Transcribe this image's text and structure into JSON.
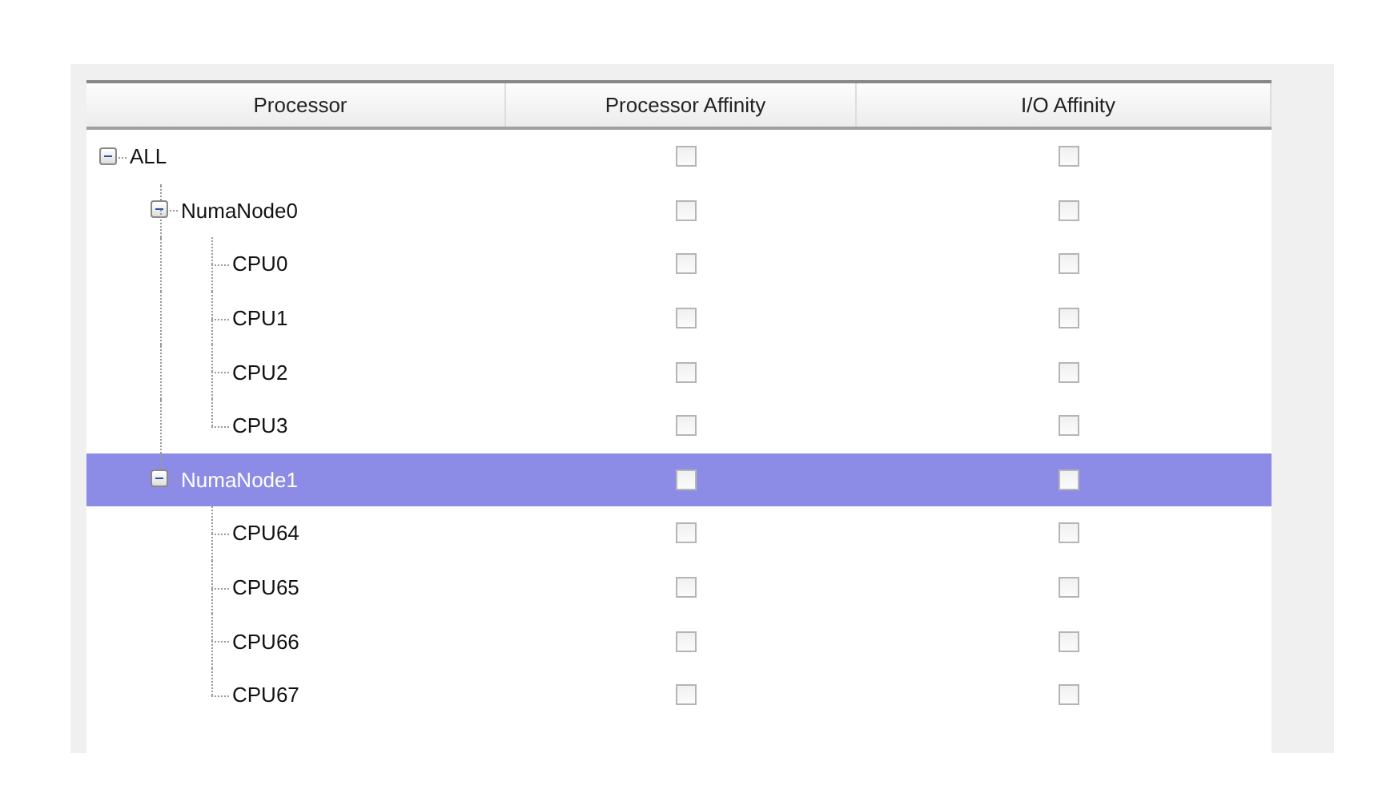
{
  "columns": [
    "Processor",
    "Processor Affinity",
    "I/O Affinity"
  ],
  "tree": [
    {
      "label": "ALL",
      "expanded": true,
      "selected": false,
      "processor_affinity": false,
      "io_affinity": false,
      "children": [
        {
          "label": "NumaNode0",
          "expanded": true,
          "selected": false,
          "processor_affinity": false,
          "io_affinity": false,
          "children": [
            {
              "label": "CPU0",
              "selected": false,
              "processor_affinity": false,
              "io_affinity": false
            },
            {
              "label": "CPU1",
              "selected": false,
              "processor_affinity": false,
              "io_affinity": false
            },
            {
              "label": "CPU2",
              "selected": false,
              "processor_affinity": false,
              "io_affinity": false
            },
            {
              "label": "CPU3",
              "selected": false,
              "processor_affinity": false,
              "io_affinity": false
            }
          ]
        },
        {
          "label": "NumaNode1",
          "expanded": true,
          "selected": true,
          "processor_affinity": false,
          "io_affinity": false,
          "children": [
            {
              "label": "CPU64",
              "selected": false,
              "processor_affinity": false,
              "io_affinity": false
            },
            {
              "label": "CPU65",
              "selected": false,
              "processor_affinity": false,
              "io_affinity": false
            },
            {
              "label": "CPU66",
              "selected": false,
              "processor_affinity": false,
              "io_affinity": false
            },
            {
              "label": "CPU67",
              "selected": false,
              "processor_affinity": false,
              "io_affinity": false
            }
          ]
        }
      ]
    }
  ]
}
